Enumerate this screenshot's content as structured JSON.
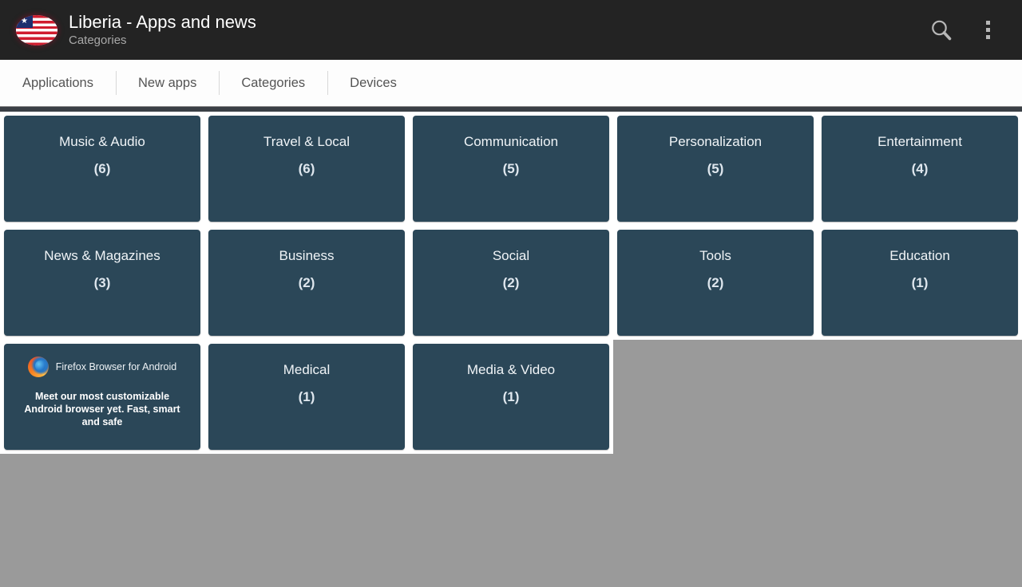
{
  "header": {
    "title": "Liberia - Apps and news",
    "subtitle": "Categories",
    "flag_icon": "liberia-flag-icon",
    "flag_star": "★",
    "search_icon": "search-icon",
    "menu_icon": "overflow-menu-icon"
  },
  "tabs": [
    {
      "label": "Applications"
    },
    {
      "label": "New apps"
    },
    {
      "label": "Categories"
    },
    {
      "label": "Devices"
    }
  ],
  "colors": {
    "header_bg": "#232323",
    "tile_bg": "#2b4758",
    "page_bg": "#9a9a9a",
    "grid_bg": "#ffffff",
    "tab_text": "#545454"
  },
  "grid": {
    "rows": [
      {
        "cells": [
          {
            "type": "category",
            "name": "Music & Audio",
            "count": "(6)"
          },
          {
            "type": "category",
            "name": "Travel & Local",
            "count": "(6)"
          },
          {
            "type": "category",
            "name": "Communication",
            "count": "(5)"
          },
          {
            "type": "category",
            "name": "Personalization",
            "count": "(5)"
          },
          {
            "type": "category",
            "name": "Entertainment",
            "count": "(4)"
          }
        ]
      },
      {
        "cells": [
          {
            "type": "category",
            "name": "News & Magazines",
            "count": "(3)"
          },
          {
            "type": "category",
            "name": "Business",
            "count": "(2)"
          },
          {
            "type": "category",
            "name": "Social",
            "count": "(2)"
          },
          {
            "type": "category",
            "name": "Tools",
            "count": "(2)"
          },
          {
            "type": "category",
            "name": "Education",
            "count": "(1)"
          }
        ]
      },
      {
        "cells": [
          {
            "type": "ad",
            "ad_icon": "firefox-logo-icon",
            "ad_title": "Firefox Browser for Android",
            "ad_description": "Meet our most customizable Android browser yet. Fast, smart and safe"
          },
          {
            "type": "category",
            "name": "Medical",
            "count": "(1)"
          },
          {
            "type": "category",
            "name": "Media & Video",
            "count": "(1)"
          },
          {
            "type": "empty"
          },
          {
            "type": "empty"
          }
        ]
      }
    ]
  }
}
